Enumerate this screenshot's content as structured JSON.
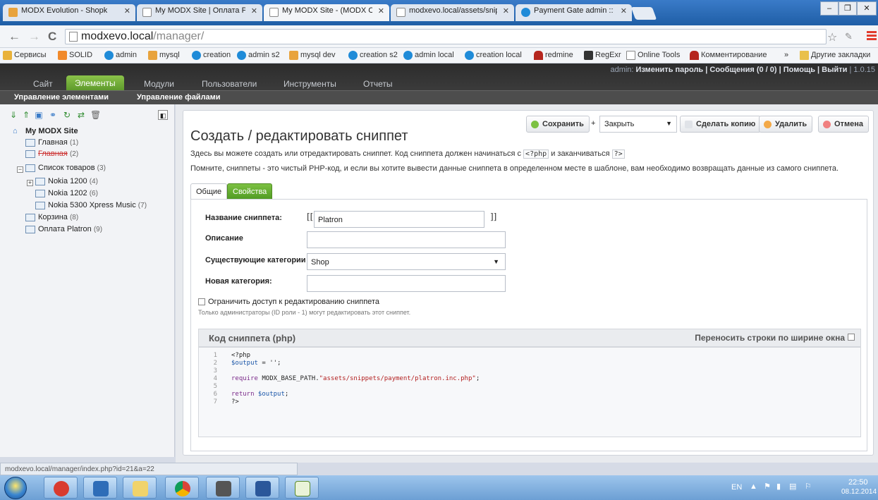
{
  "browser": {
    "tabs": [
      {
        "label": "MODX Evolution - Shopk",
        "color": "#e8a33d"
      },
      {
        "label": "My MODX Site | Оплата P",
        "color": "#9aa9bb"
      },
      {
        "label": "My MODX Site - (MODX C",
        "color": "#9aa9bb"
      },
      {
        "label": "modxevo.local/assets/snip",
        "color": "#9aa9bb"
      },
      {
        "label": "Payment Gate admin :: Тр",
        "color": "#1f8bd8"
      }
    ],
    "url_host": "modxevo.local",
    "url_path": "/manager/",
    "bookmarks": [
      "Сервисы",
      "SOLID",
      "admin",
      "mysql",
      "creation",
      "admin s2",
      "mysql dev",
      "creation s2",
      "admin local",
      "creation local",
      "redmine",
      "RegExr",
      "Online Tools",
      "Комментирование",
      "»",
      "Другие закладки"
    ],
    "status_url": "modxevo.local/manager/index.php?id=21&a=22",
    "window_buttons": [
      "–",
      "❐",
      "✕"
    ]
  },
  "modx": {
    "userinfo_prefix": "admin: ",
    "userinfo_links": "Изменить пароль | Сообщения (0 / 0) | Помощь | Выйти",
    "userinfo_version": " | 1.0.15",
    "top_tabs": [
      "Сайт",
      "Элементы",
      "Модули",
      "Пользователи",
      "Инструменты",
      "Отчеты"
    ],
    "sub_menu": [
      "Управление элементами",
      "Управление файлами"
    ],
    "tree": {
      "root": "My MODX Site",
      "nodes": [
        {
          "label": "Главная",
          "id": "(1)"
        },
        {
          "label": "Главная",
          "id": "(2)"
        },
        {
          "label": "Список товаров",
          "id": "(3)"
        },
        {
          "label": "Nokia 1200",
          "id": "(4)"
        },
        {
          "label": "Nokia 1202",
          "id": "(6)"
        },
        {
          "label": "Nokia 5300 Xpress Music",
          "id": "(7)"
        },
        {
          "label": "Корзина",
          "id": "(8)"
        },
        {
          "label": "Оплата Platron",
          "id": "(9)"
        }
      ]
    },
    "page": {
      "title": "Создать / редактировать сниппет",
      "buttons": {
        "save": "Сохранить",
        "plus": "+",
        "close_select": "Закрыть",
        "copy": "Сделать копию",
        "delete": "Удалить",
        "cancel": "Отмена"
      },
      "desc1_a": "Здесь вы можете создать или отредактировать сниппет. Код сниппета должен начинаться с",
      "desc1_code1": "<?php",
      "desc1_b": "и заканчиваться",
      "desc1_code2": "?>",
      "desc2": "Помните, сниппеты - это чистый PHP-код, и если вы хотите вывести данные сниппета в определенном месте в шаблоне, вам необходимо возвращать данные из самого сниппета.",
      "tabs": [
        "Общие",
        "Свойства"
      ],
      "form": {
        "name_label": "Название сниппета:",
        "name_value": "Platron",
        "bracket_open": "[[",
        "bracket_close": "]]",
        "desc_label": "Описание",
        "desc_value": "",
        "cat_label": "Существующие категории",
        "cat_value": "Shop",
        "newcat_label": "Новая категория:",
        "newcat_value": "",
        "lock_label": "Ограничить доступ к редактированию сниппета",
        "lock_note": "Только администраторы (ID роли - 1) могут редактировать этот сниппет."
      },
      "code": {
        "title": "Код сниппета (php)",
        "wrap_label": "Переносить строки по ширине окна",
        "lines": [
          "1",
          "2",
          "3",
          "4",
          "5",
          "6",
          "7"
        ],
        "l1": "<?php",
        "l2_var": "$output",
        "l2_rest": " = '';",
        "l4_kw": "require",
        "l4_const": " MODX_BASE_PATH.",
        "l4_str": "\"assets/snippets/payment/platron.inc.php\"",
        "l4_end": ";",
        "l6_kw": "return",
        "l6_var": " $output",
        "l6_end": ";",
        "l7": "?>"
      }
    }
  },
  "taskbar": {
    "lang": "EN",
    "time": "22:50",
    "date": "08.12.2014",
    "apps": [
      "hs",
      "virtualbox",
      "explorer",
      "chrome",
      "security",
      "word",
      "notepad"
    ]
  }
}
